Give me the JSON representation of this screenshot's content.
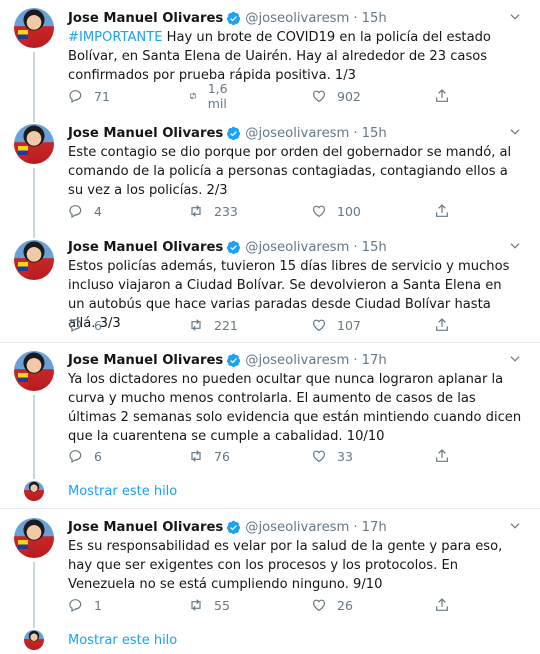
{
  "tweets": [
    {
      "name": "Jose Manuel Olivares",
      "handle": "@joseolivaresm",
      "time": "15h",
      "hashtag": "#IMPORTANTE",
      "text": " Hay un brote de COVID19 en la policía del estado Bolívar, en Santa Elena de Uairén. Hay al alrededor de 23 casos confirmados por prueba rápida positiva. 1/3",
      "replies": "71",
      "retweets": "1,6 mil",
      "likes": "902"
    },
    {
      "name": "Jose Manuel Olivares",
      "handle": "@joseolivaresm",
      "time": "15h",
      "text": "Este contagio se dio porque por orden del gobernador se mandó, al comando de la policía a personas contagiadas, contagiando ellos a su vez a los policías. 2/3",
      "replies": "4",
      "retweets": "233",
      "likes": "100"
    },
    {
      "name": "Jose Manuel Olivares",
      "handle": "@joseolivaresm",
      "time": "15h",
      "text": "Estos policías además, tuvieron 15 días libres de servicio y muchos incluso viajaron a Ciudad Bolívar. Se devolvieron a Santa Elena en un autobús que hace varias paradas desde Ciudad Bolívar hasta allá. 3/3",
      "replies": "6",
      "retweets": "221",
      "likes": "107"
    },
    {
      "name": "Jose Manuel Olivares",
      "handle": "@joseolivaresm",
      "time": "17h",
      "text": "Ya los dictadores no pueden ocultar que nunca lograron aplanar la curva y mucho menos controlarla. El aumento de casos de las últimas 2 semanas solo evidencia que están mintiendo cuando dicen que la cuarentena se cumple a cabalidad. 10/10",
      "replies": "6",
      "retweets": "76",
      "likes": "33",
      "show_thread": "Mostrar este hilo"
    },
    {
      "name": "Jose Manuel Olivares",
      "handle": "@joseolivaresm",
      "time": "17h",
      "text": "Es su responsabilidad es velar por la salud de la gente y para eso, hay que ser exigentes con los procesos y los protocolos. En Venezuela no se está cumpliendo ninguno. 9/10",
      "replies": "1",
      "retweets": "55",
      "likes": "26",
      "show_thread": "Mostrar este hilo"
    }
  ],
  "dot": "·",
  "colors": {
    "accent": "#1da1f2",
    "muted": "#657786",
    "text": "#14171a",
    "border": "#e6ecf0",
    "retweet": "#657786"
  },
  "icons": [
    "verified-badge-icon",
    "chevron-down-icon",
    "reply-icon",
    "retweet-icon",
    "like-icon",
    "share-icon"
  ]
}
